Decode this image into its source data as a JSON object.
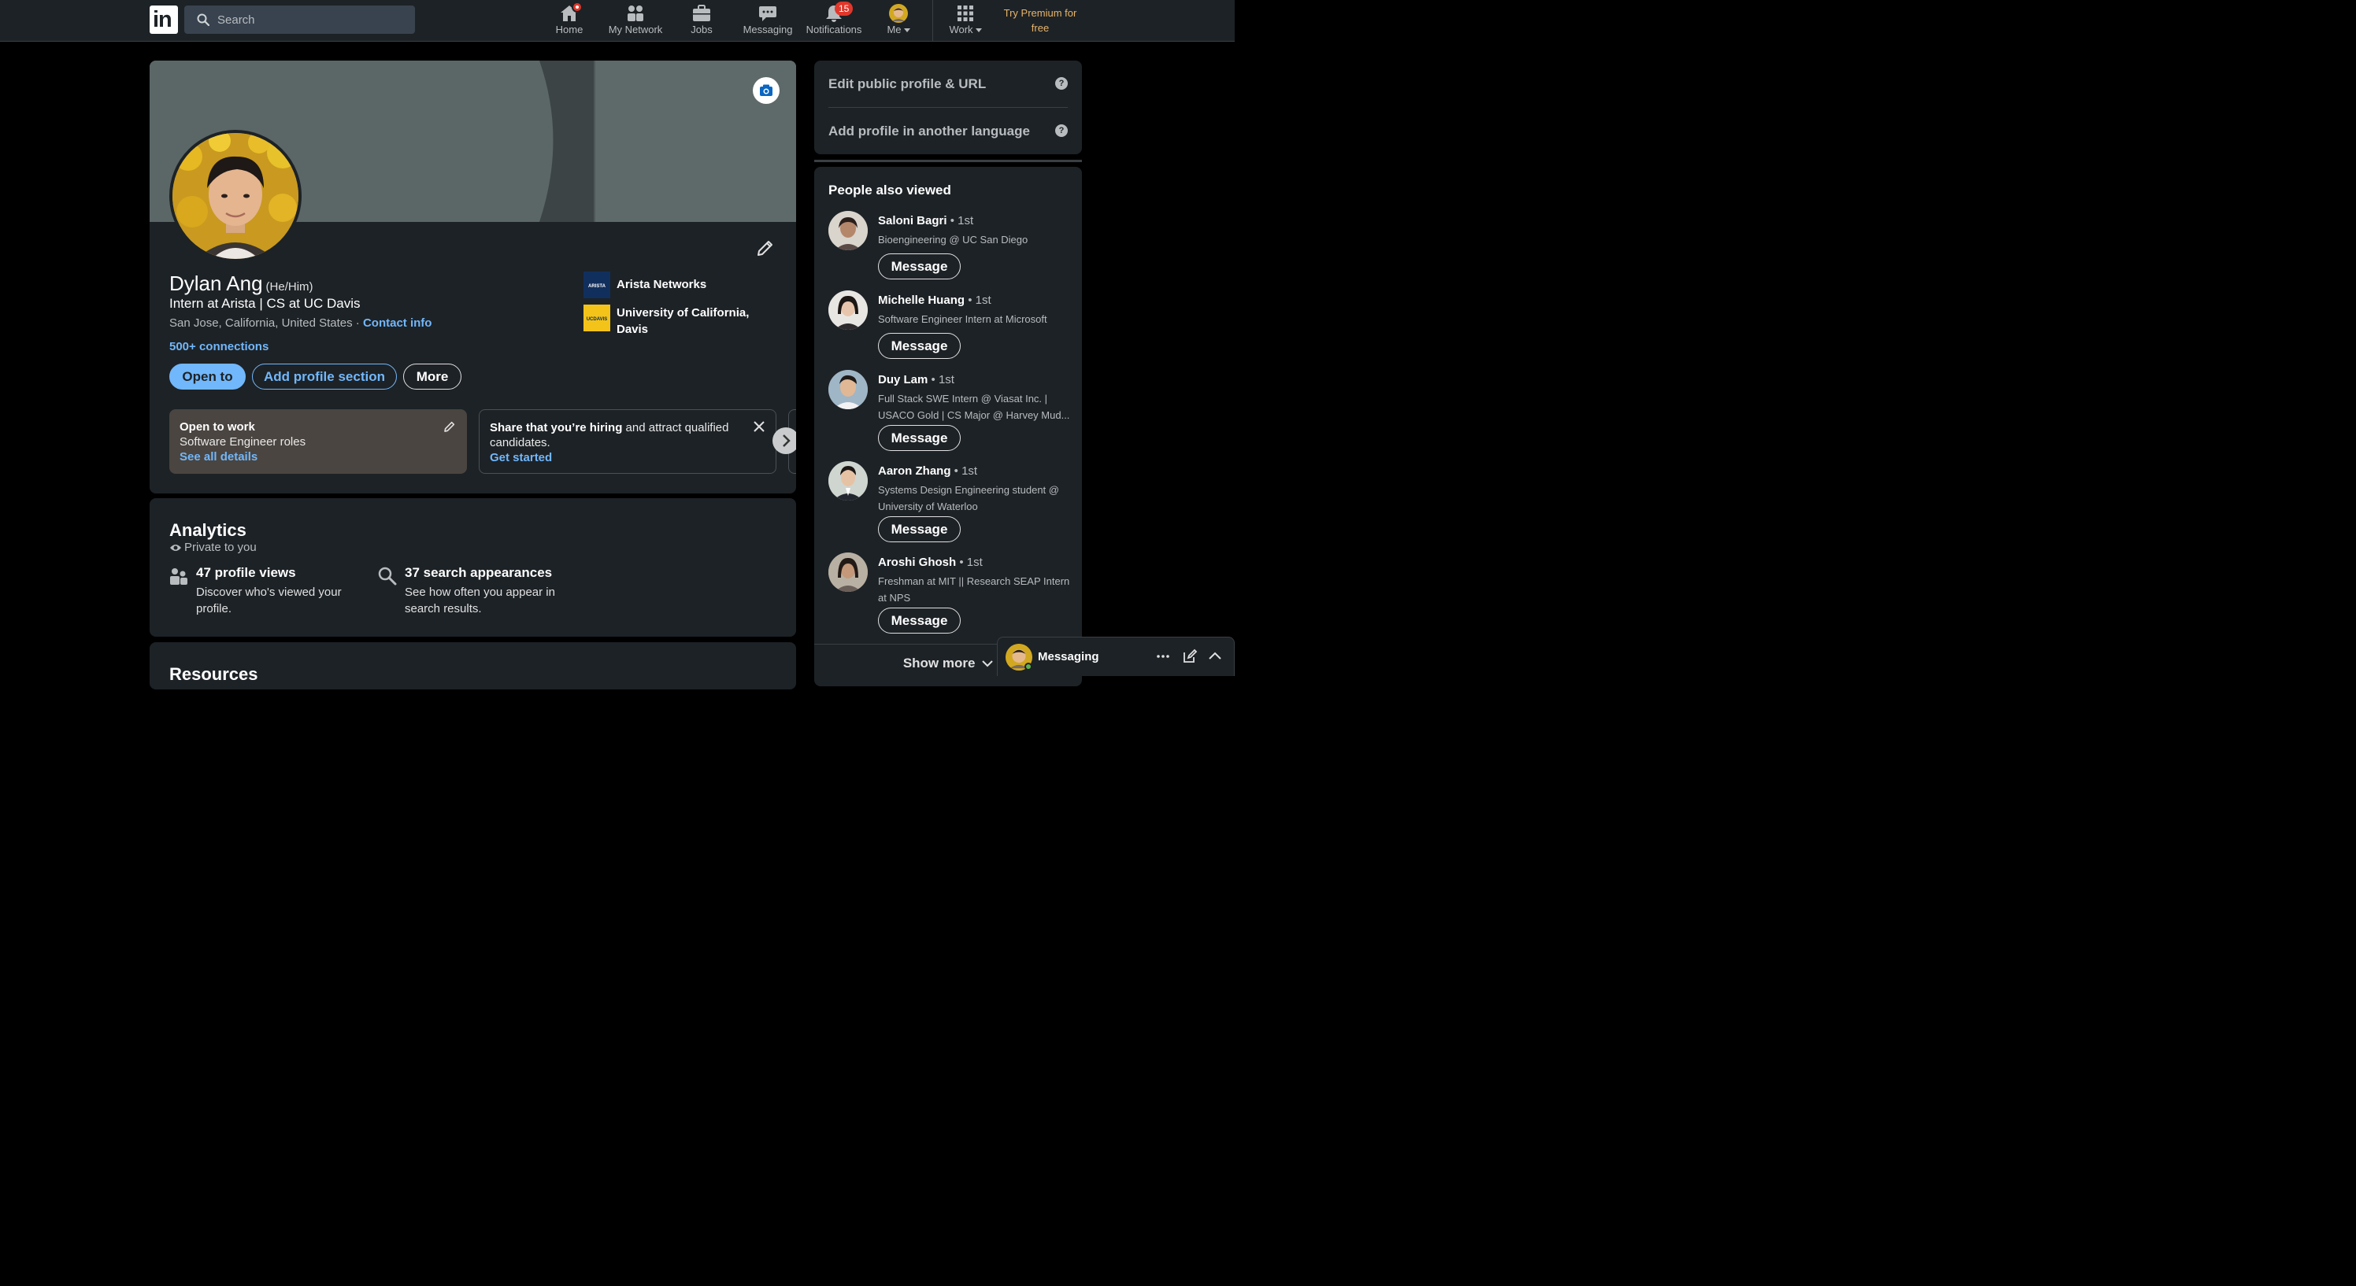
{
  "nav": {
    "logo_text": "in",
    "search_placeholder": "Search",
    "items": [
      {
        "label": "Home",
        "icon": "home-icon"
      },
      {
        "label": "My Network",
        "icon": "network-icon"
      },
      {
        "label": "Jobs",
        "icon": "briefcase-icon"
      },
      {
        "label": "Messaging",
        "icon": "chat-icon"
      },
      {
        "label": "Notifications",
        "icon": "bell-icon",
        "badge": "15"
      },
      {
        "label": "Me",
        "icon": "avatar"
      },
      {
        "label": "Work",
        "icon": "grid-icon"
      }
    ],
    "premium": "Try Premium for free"
  },
  "profile": {
    "name": "Dylan Ang",
    "pronouns": "(He/Him)",
    "headline": "Intern at Arista | CS at UC Davis",
    "location": "San Jose, California, United States",
    "location_sep": " · ",
    "contact_info": "Contact info",
    "connections": "500+ connections",
    "orgs": [
      {
        "name": "Arista Networks",
        "logo_text": "ARISTA"
      },
      {
        "name": "University of California, Davis",
        "logo_text": "UCDAVIS"
      }
    ],
    "buttons": {
      "open_to": "Open to",
      "add_section": "Add profile section",
      "more": "More"
    },
    "open_to_work": {
      "title": "Open to work",
      "roles": "Software Engineer roles",
      "link": "See all details"
    },
    "hiring": {
      "bold": "Share that you’re hiring",
      "rest": " and attract qualified candidates.",
      "link": "Get started"
    }
  },
  "analytics": {
    "title": "Analytics",
    "private": "Private to you",
    "stats": [
      {
        "title": "47 profile views",
        "desc": "Discover who's viewed your profile."
      },
      {
        "title": "37 search appearances",
        "desc": "See how often you appear in search results."
      }
    ]
  },
  "resources": {
    "title": "Resources"
  },
  "sidebar": {
    "edit_url": "Edit public profile & URL",
    "add_language": "Add profile in another language",
    "help_glyph": "?"
  },
  "people_also_viewed": {
    "title": "People also viewed",
    "message_label": "Message",
    "people": [
      {
        "name": "Saloni Bagri",
        "degree": " • 1st",
        "headline": "Bioengineering @ UC San Diego"
      },
      {
        "name": "Michelle Huang",
        "degree": " • 1st",
        "headline": "Software Engineer Intern at Microsoft"
      },
      {
        "name": "Duy Lam",
        "degree": " • 1st",
        "headline": "Full Stack SWE Intern @ Viasat Inc. | USACO Gold | CS Major @ Harvey Mud..."
      },
      {
        "name": "Aaron Zhang",
        "degree": " • 1st",
        "headline": "Systems Design Engineering student @ University of Waterloo"
      },
      {
        "name": "Aroshi Ghosh",
        "degree": " • 1st",
        "headline": "Freshman at MIT || Research SEAP Intern at NPS"
      }
    ],
    "show_more": "Show more"
  },
  "messaging_dock": {
    "label": "Messaging"
  },
  "colors": {
    "accent": "#71b7fb",
    "card": "#1d2226",
    "premium": "#e7b46a",
    "badge": "#e1372b"
  }
}
